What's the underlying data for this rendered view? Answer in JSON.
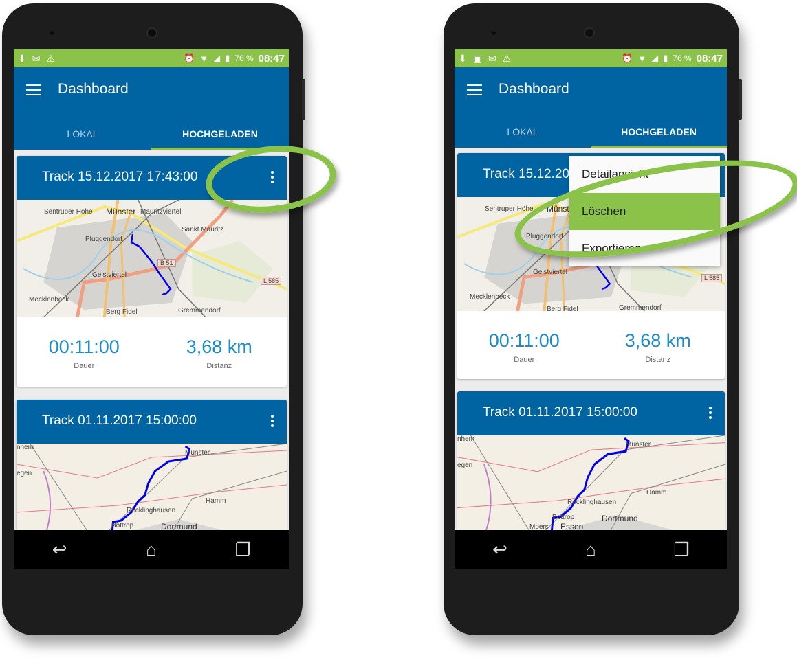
{
  "status": {
    "battery": "76 %",
    "time": "08:47",
    "icons_left": [
      "download-icon",
      "image-icon",
      "gmail-icon",
      "warning-icon"
    ],
    "icons_right": [
      "alarm-icon",
      "wifi-icon",
      "signal-icon",
      "battery-icon"
    ]
  },
  "appbar": {
    "title": "Dashboard"
  },
  "tabs": [
    {
      "label": "LOKAL"
    },
    {
      "label": "HOCHGELADEN",
      "active": true
    }
  ],
  "tracks": [
    {
      "title": "Track 15.12.2017 17:43:00",
      "duration": "00:11:00",
      "duration_label": "Dauer",
      "distance": "3,68 km",
      "distance_label": "Distanz",
      "map_labels": [
        "Sentruper Höhe",
        "Münster",
        "Mauritzviertel",
        "Sankt Mauritz",
        "Pluggendorf",
        "B 51",
        "Geistviertel",
        "L 585",
        "Mecklenbeck",
        "Gremmendorf",
        "Berg Fidel"
      ]
    },
    {
      "title": "Track 01.11.2017 15:00:00",
      "map_labels": [
        "nhem",
        "Münster",
        "egen",
        "Hamm",
        "Recklinghausen",
        "Bottrop",
        "Dortmund",
        "Moers",
        "Essen"
      ]
    }
  ],
  "context_menu": {
    "items": [
      {
        "label": "Detailansicht"
      },
      {
        "label": "Löschen",
        "highlighted": true
      },
      {
        "label": "Exportieren"
      }
    ]
  },
  "colors": {
    "primary": "#0064a3",
    "accent": "#8bc34a",
    "value": "#1a8ccc"
  }
}
